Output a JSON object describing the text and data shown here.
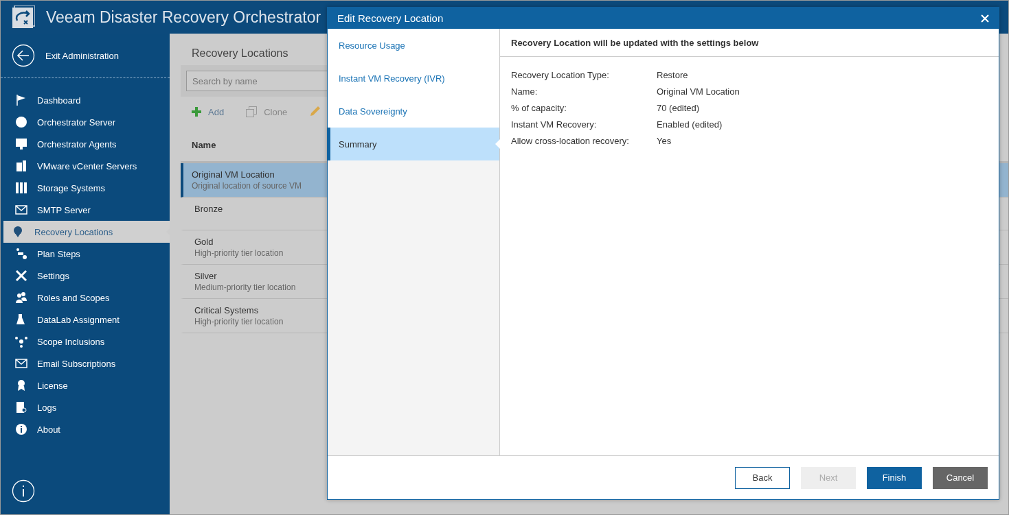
{
  "app": {
    "title": "Veeam Disaster Recovery Orchestrator"
  },
  "sidebar": {
    "exit_label": "Exit Administration",
    "items": [
      {
        "label": "Dashboard",
        "selected": false
      },
      {
        "label": "Orchestrator Server",
        "selected": false
      },
      {
        "label": "Orchestrator Agents",
        "selected": false
      },
      {
        "label": "VMware vCenter Servers",
        "selected": false
      },
      {
        "label": "Storage Systems",
        "selected": false
      },
      {
        "label": "SMTP Server",
        "selected": false
      },
      {
        "label": "Recovery Locations",
        "selected": true
      },
      {
        "label": "Plan Steps",
        "selected": false
      },
      {
        "label": "Settings",
        "selected": false
      },
      {
        "label": "Roles and Scopes",
        "selected": false
      },
      {
        "label": "DataLab Assignment",
        "selected": false
      },
      {
        "label": "Scope Inclusions",
        "selected": false
      },
      {
        "label": "Email Subscriptions",
        "selected": false
      },
      {
        "label": "License",
        "selected": false
      },
      {
        "label": "Logs",
        "selected": false
      },
      {
        "label": "About",
        "selected": false
      }
    ]
  },
  "page": {
    "title": "Recovery Locations",
    "search": {
      "placeholder": "Search by name"
    },
    "toolbar": [
      {
        "label": "Add"
      },
      {
        "label": "Clone"
      }
    ],
    "table": {
      "columns": [
        "Name"
      ],
      "rows": [
        {
          "name": "Original VM Location",
          "description": "Original location of source VM",
          "selected": true
        },
        {
          "name": "Bronze",
          "selected": false
        },
        {
          "name": "Gold",
          "description": "High-priority tier location",
          "selected": false
        },
        {
          "name": "Silver",
          "description": "Medium-priority tier location",
          "selected": false
        },
        {
          "name": "Critical Systems",
          "description": "High-priority tier location",
          "selected": false
        }
      ]
    }
  },
  "dialog": {
    "title": "Edit Recovery Location",
    "steps": [
      {
        "label": "Resource Usage",
        "selected": false
      },
      {
        "label": "Instant VM Recovery (IVR)",
        "selected": false
      },
      {
        "label": "Data Sovereignty",
        "selected": false
      },
      {
        "label": "Summary",
        "selected": true
      }
    ],
    "heading": "Recovery Location will be updated with the settings below",
    "summary": [
      {
        "label": "Recovery Location Type:",
        "value": "Restore"
      },
      {
        "label": "Name:",
        "value": "Original VM Location"
      },
      {
        "label": "% of capacity:",
        "value": "70 (edited)"
      },
      {
        "label": "Instant VM Recovery:",
        "value": "Enabled (edited)"
      },
      {
        "label": "Allow cross-location recovery:",
        "value": "Yes"
      }
    ],
    "buttons": [
      {
        "label": "Back",
        "kind": "outline"
      },
      {
        "label": "Next",
        "kind": "disabled"
      },
      {
        "label": "Finish",
        "kind": "primary"
      },
      {
        "label": "Cancel",
        "kind": "secondary"
      }
    ]
  }
}
